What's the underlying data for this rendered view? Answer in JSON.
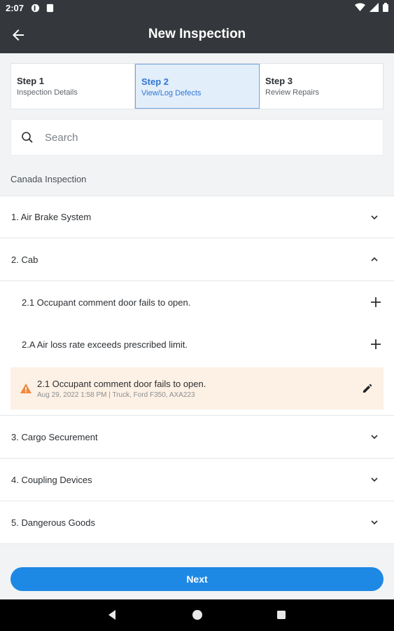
{
  "status": {
    "time": "2:07"
  },
  "appbar": {
    "title": "New Inspection",
    "back_icon": "arrow-left-icon"
  },
  "steps": [
    {
      "number": "Step 1",
      "label": "Inspection Details",
      "active": false
    },
    {
      "number": "Step 2",
      "label": "View/Log Defects",
      "active": true
    },
    {
      "number": "Step 3",
      "label": "Review Repairs",
      "active": false
    }
  ],
  "search": {
    "placeholder": "Search"
  },
  "section_label": "Canada Inspection",
  "categories": {
    "c1": "1. Air Brake System",
    "c2": "2. Cab",
    "c3": "3. Cargo Securement",
    "c4": "4. Coupling Devices",
    "c5": "5. Dangerous Goods"
  },
  "cab_items": [
    "2.1 Occupant comment door fails to open.",
    "2.A Air loss rate exceeds prescribed limit."
  ],
  "defect": {
    "title": "2.1 Occupant comment door fails to open.",
    "meta": "Aug 29, 2022 1:58 PM | Truck, Ford F350, AXA223",
    "accent_color": "#f0883e"
  },
  "footer": {
    "next_label": "Next"
  },
  "colors": {
    "primary": "#1e88e5",
    "appbar": "#34373b",
    "active_step": "#2f76d2"
  }
}
